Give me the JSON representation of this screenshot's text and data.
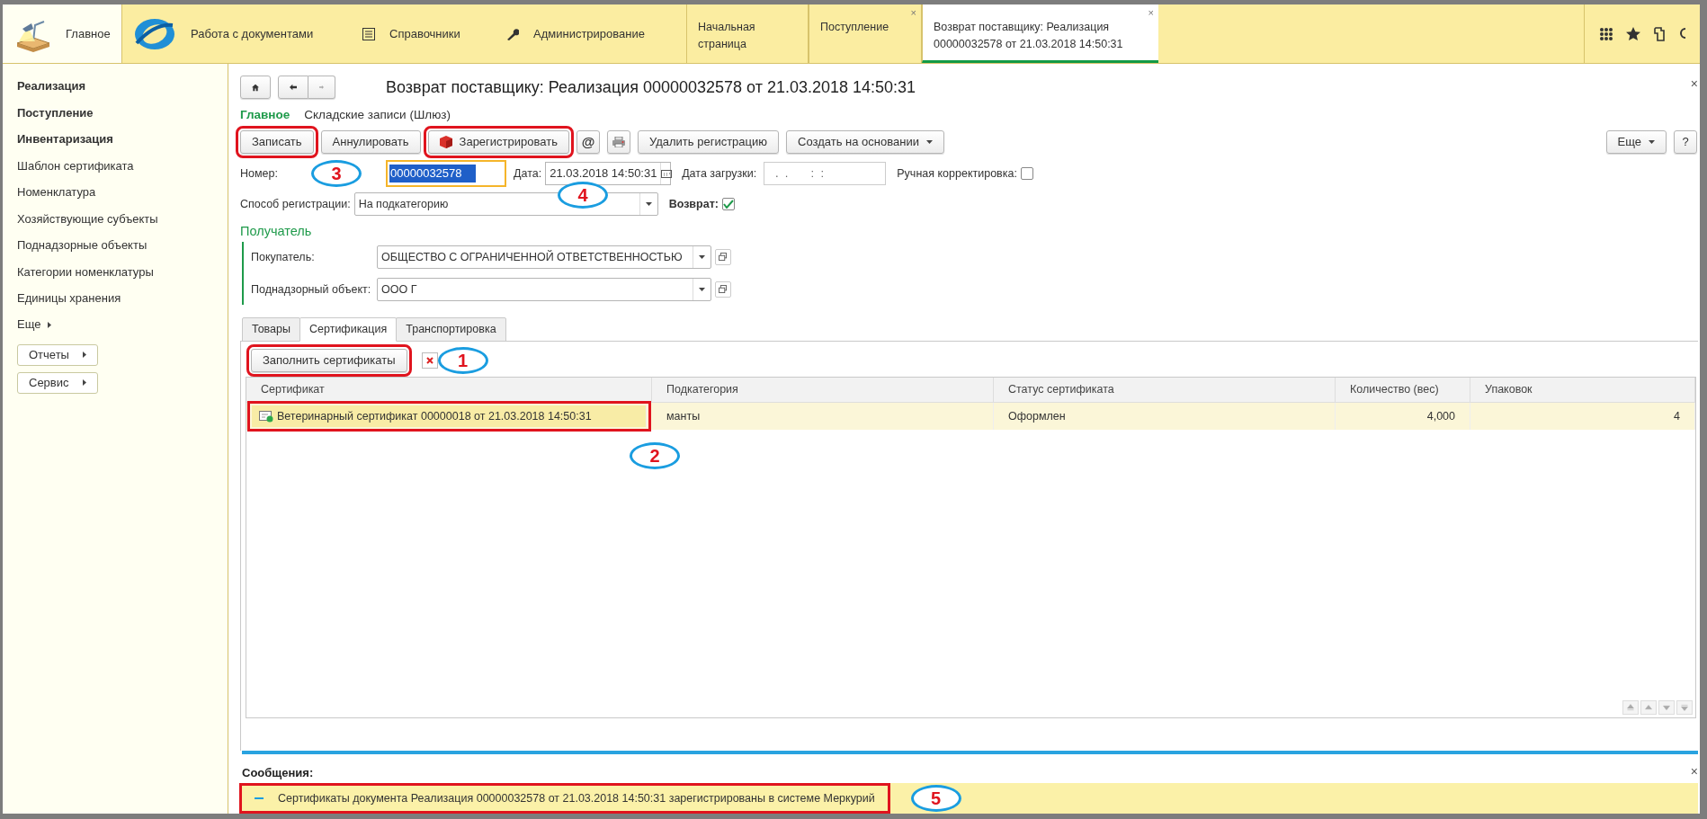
{
  "top_nav": {
    "sections": [
      {
        "label": "Главное",
        "selected": true
      },
      {
        "label": "Работа с документами",
        "selected": false
      },
      {
        "label": "Справочники",
        "selected": false
      },
      {
        "label": "Администрирование",
        "selected": false
      }
    ],
    "open_tabs": [
      {
        "label": "Начальная страница",
        "selected": false
      },
      {
        "label": "Поступление",
        "selected": false,
        "close": "×"
      },
      {
        "label": "Возврат поставщику: Реализация 00000032578 от 21.03.2018 14:50:31",
        "selected": true,
        "close": "×"
      }
    ]
  },
  "sidebar": {
    "items": [
      {
        "label": "Реализация",
        "bold": true
      },
      {
        "label": "Поступление",
        "bold": true
      },
      {
        "label": "Инвентаризация",
        "bold": true
      },
      {
        "label": "Шаблон сертификата",
        "bold": false
      },
      {
        "label": "Номенклатура",
        "bold": false
      },
      {
        "label": "Хозяйствующие субъекты",
        "bold": false
      },
      {
        "label": "Поднадзорные объекты",
        "bold": false
      },
      {
        "label": "Категории номенклатуры",
        "bold": false
      },
      {
        "label": "Единицы хранения",
        "bold": false
      }
    ],
    "more": "Еще",
    "buttons": [
      "Отчеты",
      "Сервис"
    ]
  },
  "form": {
    "title": "Возврат поставщику: Реализация 00000032578 от 21.03.2018 14:50:31",
    "close": "×",
    "nav_tabs": [
      {
        "label": "Главное",
        "selected": true
      },
      {
        "label": "Складские записи (Шлюз)",
        "selected": false
      }
    ],
    "toolbar": [
      {
        "kind": "button",
        "label": "Записать",
        "highlighted": true
      },
      {
        "kind": "button",
        "label": "Аннулировать",
        "highlighted": false
      },
      {
        "kind": "register",
        "label": "Зарегистрировать",
        "highlighted": true
      },
      {
        "kind": "at",
        "label": "@",
        "highlighted": false
      },
      {
        "kind": "print",
        "highlighted": false
      },
      {
        "kind": "button",
        "label": "Удалить регистрацию",
        "highlighted": false
      },
      {
        "kind": "dropdown",
        "label": "Создать на основании",
        "highlighted": false
      }
    ],
    "more_button": "Еще",
    "help_button": "?",
    "number": {
      "label": "Номер:",
      "value": "00000032578",
      "callout": "3"
    },
    "date": {
      "label": "Дата:",
      "value": "21.03.2018 14:50:31",
      "callout": "4"
    },
    "load_date": {
      "label": "Дата загрузки:",
      "value": " .  .       :  :"
    },
    "manual_correction": {
      "label": "Ручная корректировка:",
      "checked": false
    },
    "registration_method": {
      "label": "Способ регистрации:",
      "value": "На подкатегорию"
    },
    "return": {
      "label": "Возврат:",
      "checked": true
    },
    "recipient": {
      "title": "Получатель",
      "fields": [
        {
          "label": "Покупатель:",
          "value": "ОБЩЕСТВО С ОГРАНИЧЕННОЙ ОТВЕТСТВЕННОСТЬЮ"
        },
        {
          "label": "Поднадзорный объект:",
          "value": "ООО Г"
        }
      ]
    },
    "tabs": [
      {
        "label": "Товары",
        "selected": false
      },
      {
        "label": "Сертификация",
        "selected": true
      },
      {
        "label": "Транспортировка",
        "selected": false
      }
    ],
    "fill_button": {
      "label": "Заполнить сертификаты",
      "highlighted": true,
      "callout": "1"
    },
    "table": {
      "columns": [
        "Сертификат",
        "Подкатегория",
        "Статус сертификата",
        "Количество (вес)",
        "Упаковок"
      ],
      "rows": [
        {
          "cells": [
            "Ветеринарный сертификат 00000018 от 21.03.2018 14:50:31",
            "манты",
            "Оформлен",
            "4,000",
            "4"
          ],
          "selected": true,
          "highlighted": true,
          "callout": "2"
        }
      ]
    }
  },
  "messages": {
    "title": "Сообщения:",
    "close": "×",
    "items": [
      {
        "text": "Сертификаты документа Реализация 00000032578 от 21.03.2018 14:50:31 зарегистрированы в системе Меркурий",
        "highlighted": true,
        "callout": "5"
      }
    ]
  }
}
